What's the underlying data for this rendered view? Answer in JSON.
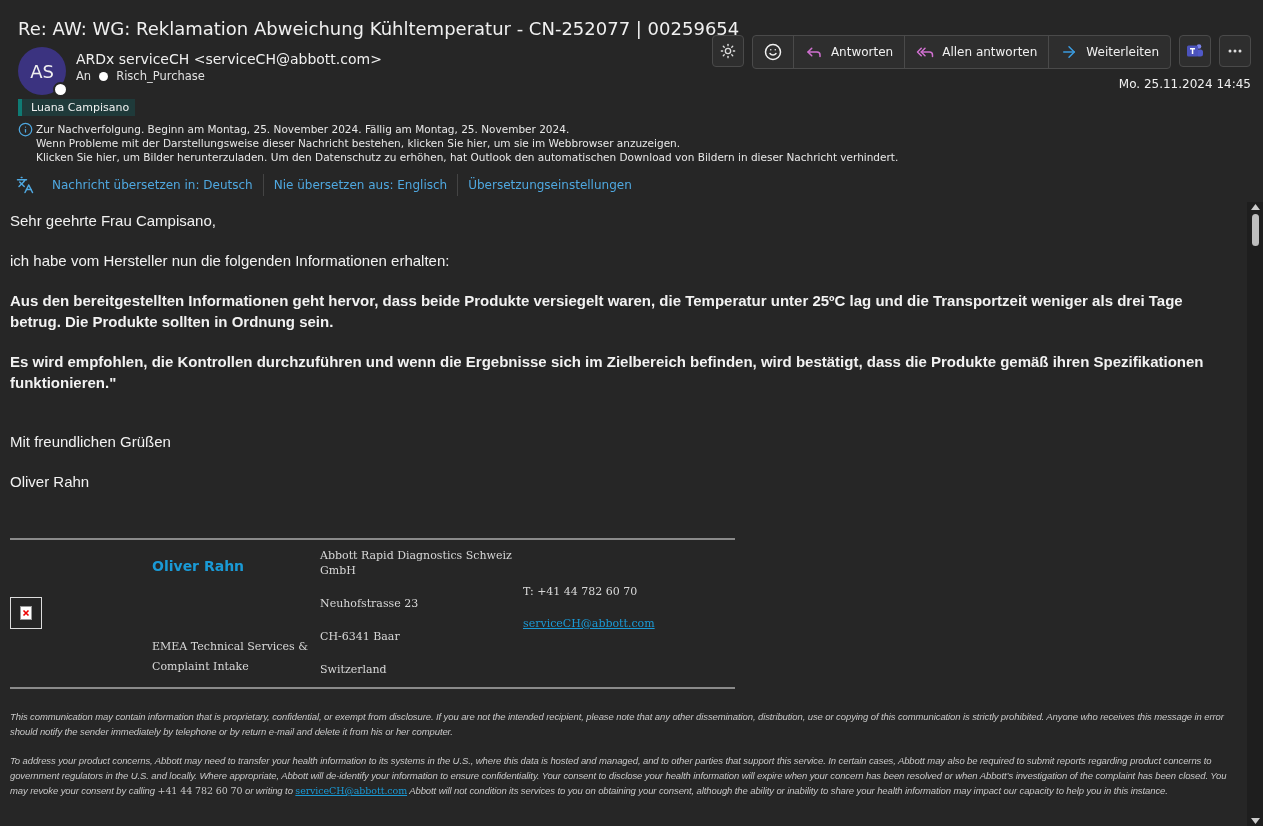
{
  "title": "Re: AW: WG: Reklamation Abweichung Kühltemperatur - CN-252077 | 00259654",
  "sender": {
    "initials": "AS",
    "name": "ARDx serviceCH",
    "address": "<serviceCH@abbott.com>",
    "to_label": "An",
    "recipient": "Risch_Purchase"
  },
  "actions": [
    {
      "kind": "theme"
    },
    {
      "kind": "group",
      "items": [
        {
          "kind": "emoji"
        },
        {
          "kind": "reply",
          "label": "Antworten"
        },
        {
          "kind": "reply-all",
          "label": "Allen antworten"
        },
        {
          "kind": "forward",
          "label": "Weiterleiten"
        }
      ]
    },
    {
      "kind": "teams"
    },
    {
      "kind": "more"
    }
  ],
  "date": "Mo. 25.11.2024 14:45",
  "category": {
    "label": "Luana Campisano",
    "color": "#0f7b74"
  },
  "info_lines": [
    "Zur Nachverfolgung.  Beginn am Montag, 25. November 2024.  Fällig am Montag, 25. November 2024.",
    "Wenn Probleme mit der Darstellungsweise dieser Nachricht bestehen, klicken Sie hier, um sie im Webbrowser anzuzeigen.",
    "Klicken Sie hier, um Bilder herunterzuladen. Um den Datenschutz zu erhöhen, hat Outlook den automatischen Download von Bildern in dieser Nachricht verhindert."
  ],
  "translate_links": [
    "Nachricht übersetzen in: Deutsch",
    "Nie übersetzen aus: Englisch",
    "Übersetzungseinstellungen"
  ],
  "body": [
    {
      "kind": "text",
      "text": "Sehr geehrte Frau Campisano,"
    },
    {
      "kind": "text",
      "text": "ich habe vom Hersteller nun die folgenden Informationen erhalten:"
    },
    {
      "kind": "bold",
      "text": "Aus den bereitgestellten Informationen geht hervor, dass beide Produkte versiegelt waren, die Temperatur unter 25ºC lag und die Transportzeit weniger als drei Tage betrug. Die Produkte sollten in Ordnung sein."
    },
    {
      "kind": "bold",
      "text": "Es wird empfohlen, die Kontrollen durchzuführen und wenn die Ergebnisse sich im Zielbereich befinden, wird bestätigt, dass die Produkte gemäß ihren Spezifikationen funktionieren.\""
    },
    {
      "kind": "closing",
      "text": "Mit freundlichen Grüßen"
    },
    {
      "kind": "text",
      "text": "Oliver Rahn"
    }
  ],
  "signature": {
    "name": "Oliver Rahn",
    "role_lines": [
      "EMEA Technical Services &",
      "Complaint Intake"
    ],
    "company_lines": [
      "Abbott Rapid Diagnostics Schweiz GmbH",
      "Neuhofstrasse 23",
      "CH-6341 Baar",
      "Switzerland"
    ],
    "phone": "T: +41 44 782 60 70",
    "email": "serviceCH@abbott.com"
  },
  "disclaimers": [
    {
      "parts": [
        {
          "kind": "text",
          "text": "This communication may contain information that is proprietary, confidential, or exempt from disclosure. If you are not the intended recipient, please note that any other dissemination, distribution, use or copying of this communication is strictly prohibited. Anyone who receives this message in error should notify the sender immediately by telephone or by return e-mail and delete it from his or her computer."
        }
      ]
    },
    {
      "parts": [
        {
          "kind": "text",
          "text": "To address your product concerns, Abbott may need to transfer your health information to its systems in the U.S., where this data is hosted and managed, and to other parties that support this service. In certain cases, Abbott may also be required to submit reports regarding product concerns to government regulators in the U.S. and locally. Where appropriate, Abbott will de-identify your information to ensure confidentiality. Your consent to disclose your health information will expire when your concern has been resolved or when Abbott’s investigation of the complaint has been closed. You may revoke your consent by calling "
        },
        {
          "kind": "phone",
          "text": "+41 44 782 60 70"
        },
        {
          "kind": "text",
          "text": "  or writing to  "
        },
        {
          "kind": "link",
          "text": "serviceCH@abbott.com"
        },
        {
          "kind": "text",
          "text": " Abbott will not condition its services to you on obtaining your consent, although the ability or inability to share your health information may impact our capacity to help you in this instance."
        }
      ]
    }
  ]
}
